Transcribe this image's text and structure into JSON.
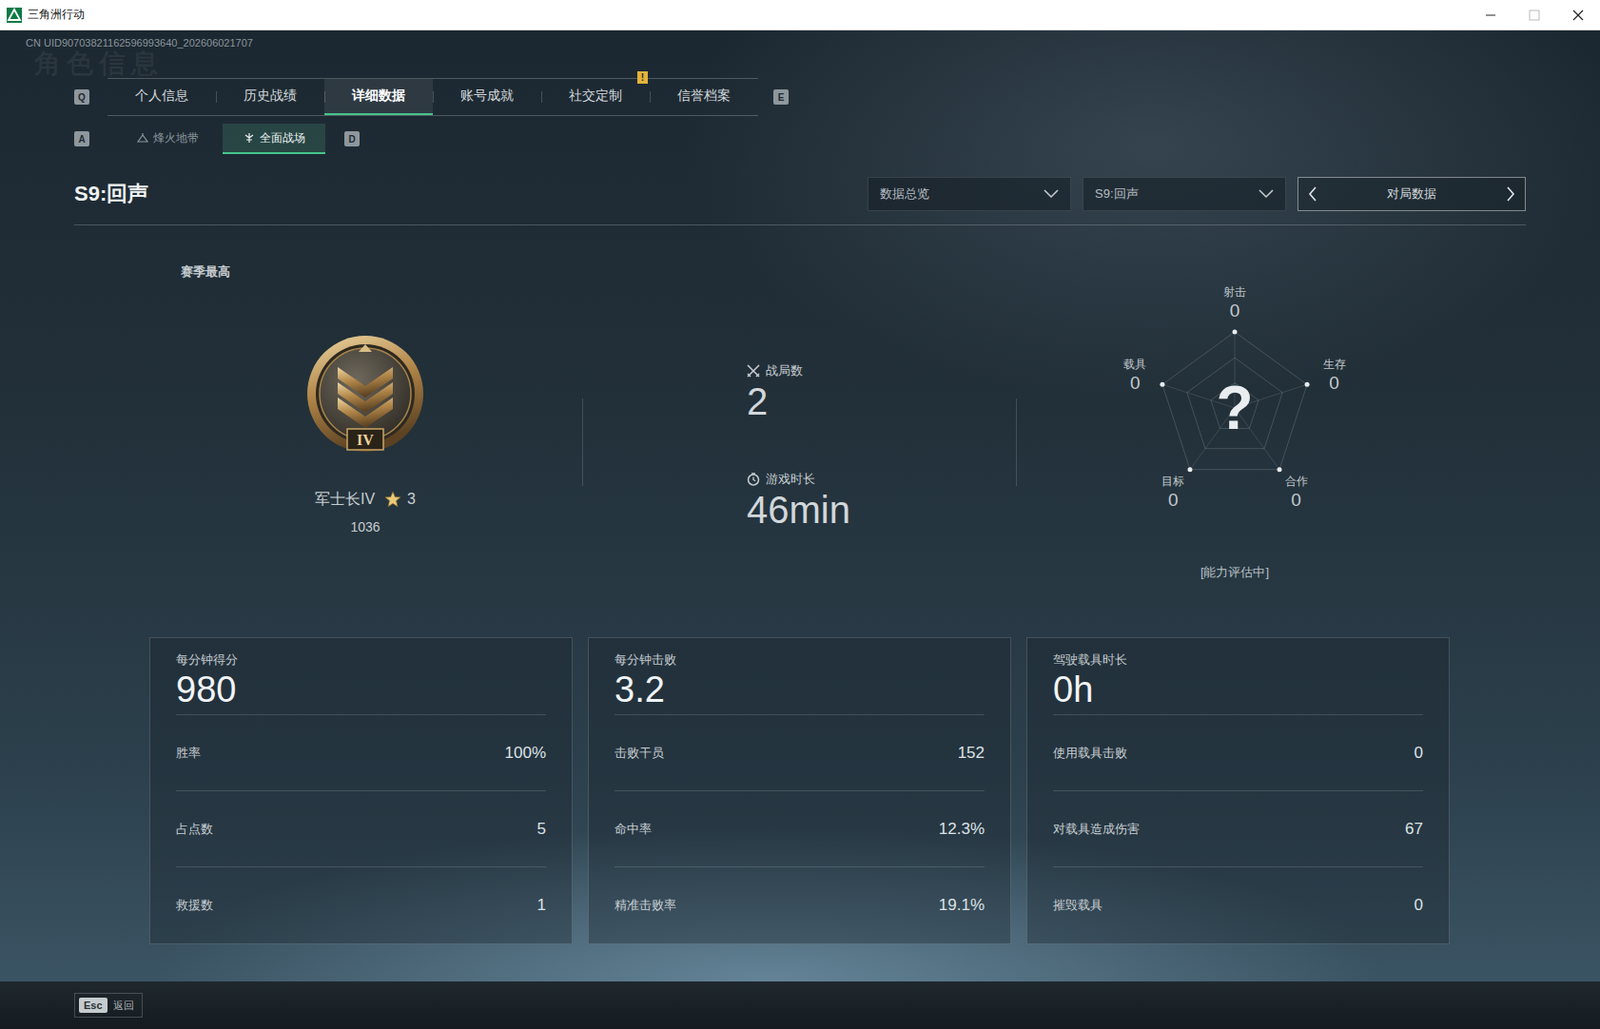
{
  "window": {
    "title": "三角洲行动"
  },
  "uid": "CN UID90703821162596993640_202606021707",
  "watermark": "角色信息",
  "tabs": {
    "prev_key": "Q",
    "next_key": "E",
    "items": [
      {
        "label": "个人信息",
        "selected": false,
        "badge": ""
      },
      {
        "label": "历史战绩",
        "selected": false,
        "badge": ""
      },
      {
        "label": "详细数据",
        "selected": true,
        "badge": ""
      },
      {
        "label": "账号成就",
        "selected": false,
        "badge": ""
      },
      {
        "label": "社交定制",
        "selected": false,
        "badge": "!"
      },
      {
        "label": "信誉档案",
        "selected": false,
        "badge": ""
      }
    ]
  },
  "mode_tabs": {
    "prev_key": "A",
    "next_key": "D",
    "items": [
      {
        "label": "烽火地带",
        "selected": false
      },
      {
        "label": "全面战场",
        "selected": true
      }
    ]
  },
  "header": {
    "title": "S9:回声",
    "filters": [
      "数据总览",
      "S9:回声"
    ],
    "pager": "对局数据"
  },
  "rank": {
    "caption": "赛季最高",
    "badge": "IV",
    "name": "军士长IV",
    "star_count": "3",
    "score": "1036"
  },
  "summary": [
    {
      "label": "战局数",
      "value": "2",
      "kind": "matches"
    },
    {
      "label": "游戏时长",
      "value": "46min",
      "kind": "time"
    }
  ],
  "radar": {
    "center": "?",
    "status": "[能力评估中]",
    "axes": [
      {
        "label": "射击",
        "value": "0"
      },
      {
        "label": "生存",
        "value": "0"
      },
      {
        "label": "合作",
        "value": "0"
      },
      {
        "label": "目标",
        "value": "0"
      },
      {
        "label": "载具",
        "value": "0"
      }
    ]
  },
  "cards": [
    {
      "title": "每分钟得分",
      "value": "980",
      "rows": [
        {
          "label": "胜率",
          "value": "100%"
        },
        {
          "label": "占点数",
          "value": "5"
        },
        {
          "label": "救援数",
          "value": "1"
        }
      ]
    },
    {
      "title": "每分钟击败",
      "value": "3.2",
      "rows": [
        {
          "label": "击败干员",
          "value": "152"
        },
        {
          "label": "命中率",
          "value": "12.3%"
        },
        {
          "label": "精准击败率",
          "value": "19.1%"
        }
      ]
    },
    {
      "title": "驾驶载具时长",
      "value": "0h",
      "rows": [
        {
          "label": "使用载具击败",
          "value": "0"
        },
        {
          "label": "对载具造成伤害",
          "value": "67"
        },
        {
          "label": "摧毁载具",
          "value": "0"
        }
      ]
    }
  ],
  "footer": {
    "key": "Esc",
    "label": "返回"
  }
}
